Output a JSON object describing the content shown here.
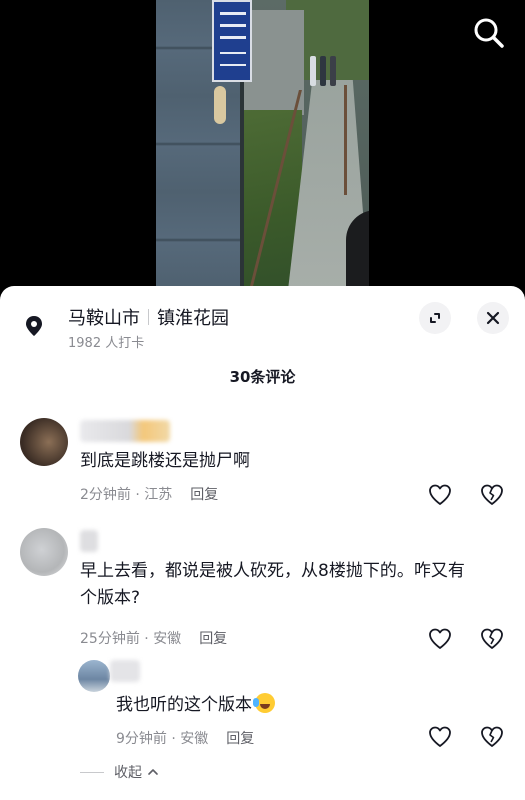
{
  "video": {
    "icons": {
      "search": "search-icon"
    }
  },
  "location": {
    "city": "马鞍山市",
    "place": "镇淮花园",
    "checkins": "1982 人打卡",
    "icons": {
      "pin": "location-pin-icon",
      "expand": "expand-icon",
      "close": "close-icon"
    }
  },
  "comments_header": {
    "title": "30条评论"
  },
  "comments": [
    {
      "text": "到底是跳楼还是抛尸啊",
      "time": "2分钟前",
      "region": "江苏",
      "reply_label": "回复"
    },
    {
      "text": "早上去看，都说是被人砍死，从8楼抛下的。咋又有个版本?",
      "time": "25分钟前",
      "region": "安徽",
      "reply_label": "回复"
    }
  ],
  "reply": {
    "text": "我也听的这个版本",
    "time": "9分钟前",
    "region": "安徽",
    "reply_label": "回复",
    "emoji": "crying-laughing-emoji"
  },
  "collapse_label": "收起",
  "colors": {
    "sheet": "#ffffff",
    "primary_text": "#161823",
    "meta_text": "#8a8b91"
  }
}
